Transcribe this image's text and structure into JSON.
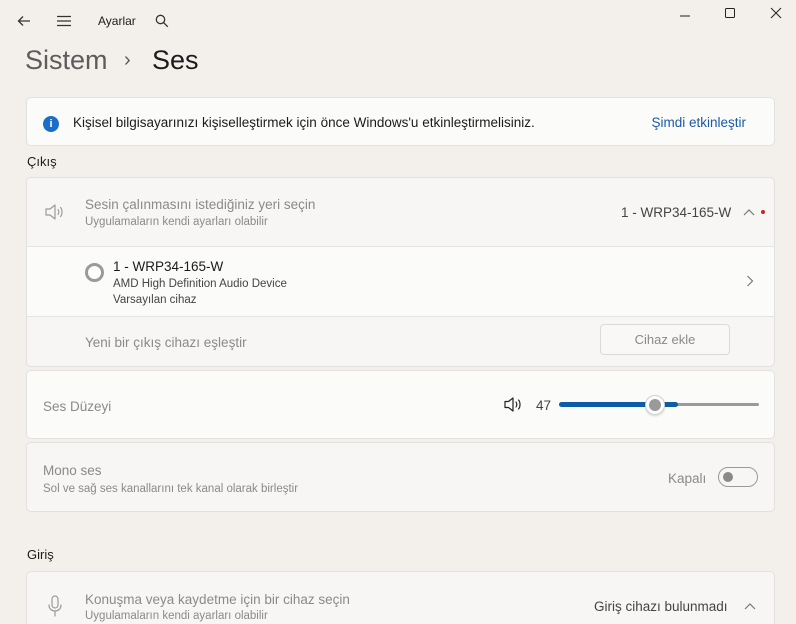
{
  "titlebar": {
    "app_title": "Ayarlar"
  },
  "breadcrumb": {
    "parent": "Sistem",
    "separator": "›",
    "current": "Ses"
  },
  "activation_banner": {
    "message": "Kişisel bilgisayarınızı kişiselleştirmek için önce Windows'u etkinleştirmelisiniz.",
    "link": "Şimdi etkinleştir"
  },
  "output": {
    "section_label": "Çıkış",
    "choose_title": "Sesin çalınmasını istediğiniz yeri seçin",
    "choose_subtitle": "Uygulamaların kendi ayarları olabilir",
    "selected_device": "1 - WRP34-165-W",
    "device": {
      "name": "1 - WRP34-165-W",
      "driver": "AMD High Definition Audio Device",
      "status": "Varsayılan cihaz"
    },
    "pair_label": "Yeni bir çıkış cihazı eşleştir",
    "add_button": "Cihaz ekle"
  },
  "volume": {
    "label": "Ses Düzeyi",
    "value": "47",
    "level_percent": 47
  },
  "mono": {
    "title": "Mono ses",
    "subtitle": "Sol ve sağ ses kanallarını tek kanal olarak birleştir",
    "state": "Kapalı",
    "on": false
  },
  "input": {
    "section_label": "Giriş",
    "choose_title": "Konuşma veya kaydetme için bir cihaz seçin",
    "choose_subtitle": "Uygulamaların kendi ayarları olabilir",
    "status": "Giriş cihazı bulunmadı"
  },
  "colors": {
    "accent": "#0c5ca6",
    "link": "#1a5aa6",
    "info": "#1a6ec7",
    "alert_dot": "#c42b1c"
  }
}
